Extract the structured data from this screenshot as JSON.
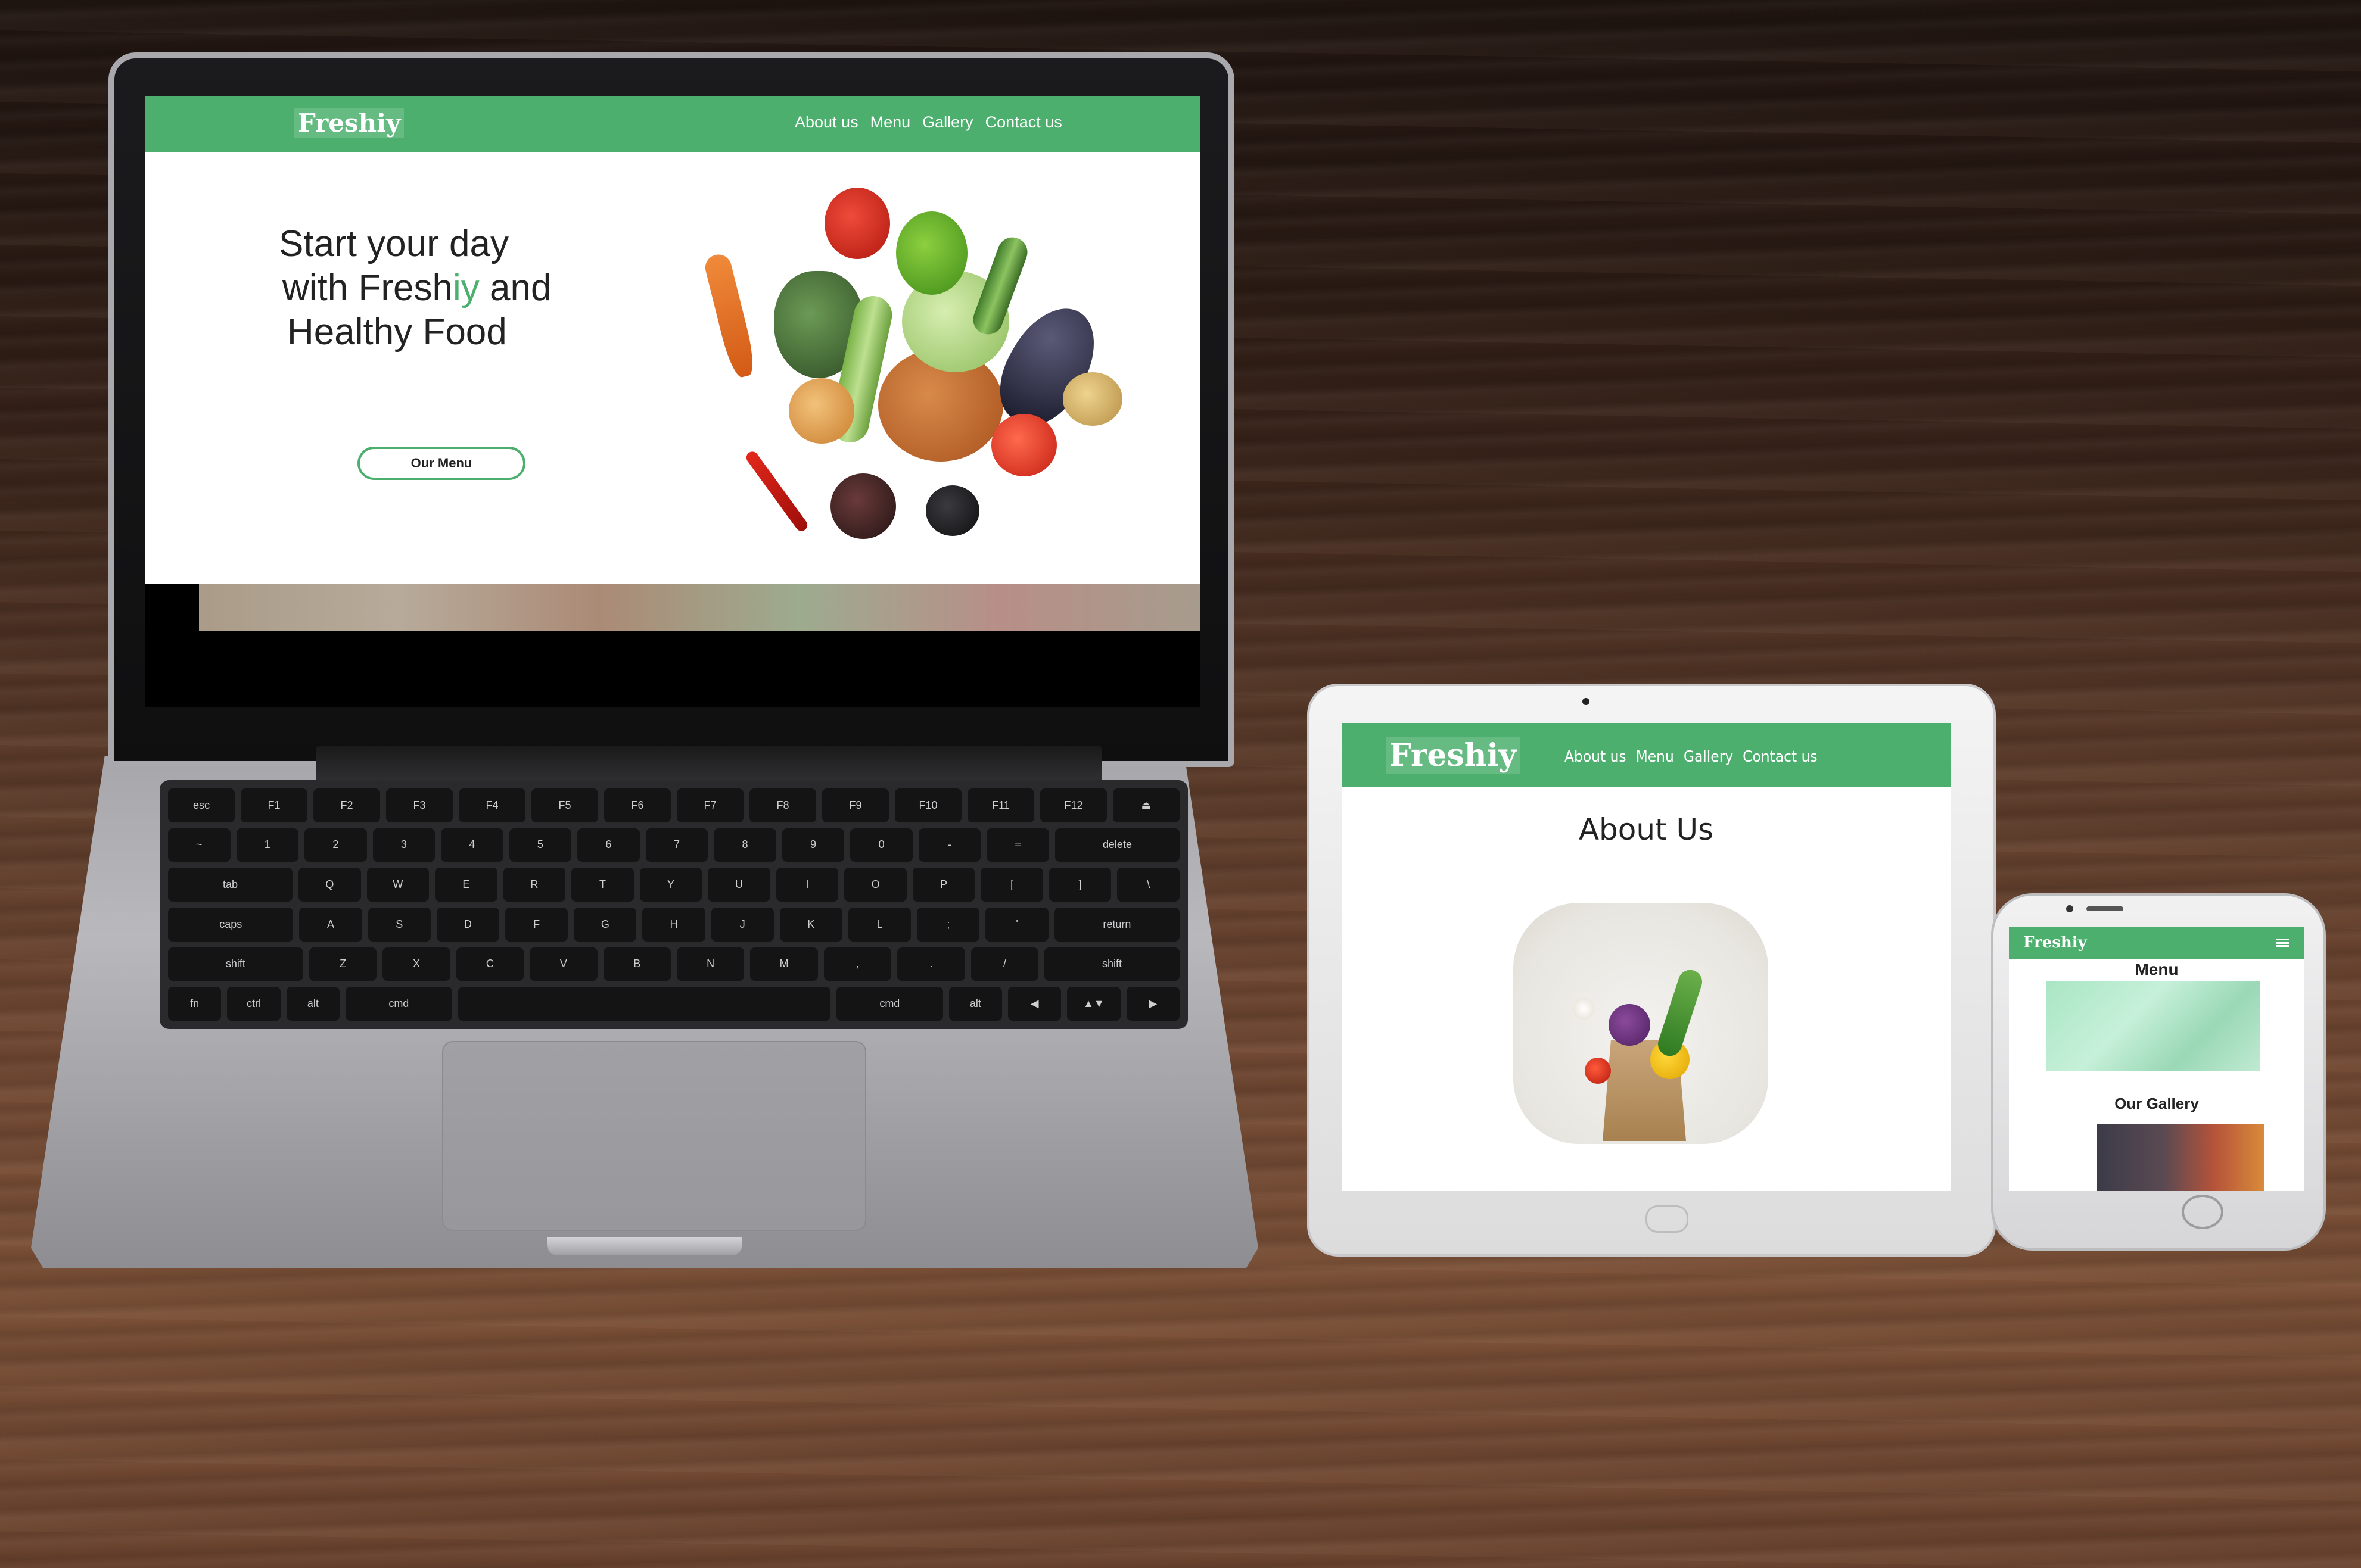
{
  "laptop": {
    "brand": "Freshiy",
    "nav": [
      "About us",
      "Menu",
      "Gallery",
      "Contact us"
    ],
    "hero": {
      "line1": "Start your day",
      "line2_pre": "with Fresh",
      "line2_hl": "iy",
      "line2_post": " and",
      "line3": "Healthy Food",
      "button": "Our Menu"
    }
  },
  "tablet": {
    "brand": "Freshiy",
    "nav": [
      "About us",
      "Menu",
      "Gallery",
      "Contact us"
    ],
    "section_title": "About Us"
  },
  "phone": {
    "brand": "Freshiy",
    "menu_title": "Menu",
    "gallery_title": "Our Gallery"
  },
  "keyboard": {
    "rows": [
      [
        "esc",
        "F1",
        "F2",
        "F3",
        "F4",
        "F5",
        "F6",
        "F7",
        "F8",
        "F9",
        "F10",
        "F11",
        "F12",
        "⏏"
      ],
      [
        "~",
        "1",
        "2",
        "3",
        "4",
        "5",
        "6",
        "7",
        "8",
        "9",
        "0",
        "-",
        "=",
        "delete"
      ],
      [
        "tab",
        "Q",
        "W",
        "E",
        "R",
        "T",
        "Y",
        "U",
        "I",
        "O",
        "P",
        "[",
        "]",
        "\\"
      ],
      [
        "caps",
        "A",
        "S",
        "D",
        "F",
        "G",
        "H",
        "J",
        "K",
        "L",
        ";",
        "'",
        "return"
      ],
      [
        "shift",
        "Z",
        "X",
        "C",
        "V",
        "B",
        "N",
        "M",
        ",",
        ".",
        "/",
        "shift"
      ],
      [
        "fn",
        "ctrl",
        "alt",
        "cmd",
        "",
        "cmd",
        "alt",
        "◀",
        "▲▼",
        "▶"
      ]
    ]
  },
  "colors": {
    "brand_green": "#4caf6e"
  }
}
